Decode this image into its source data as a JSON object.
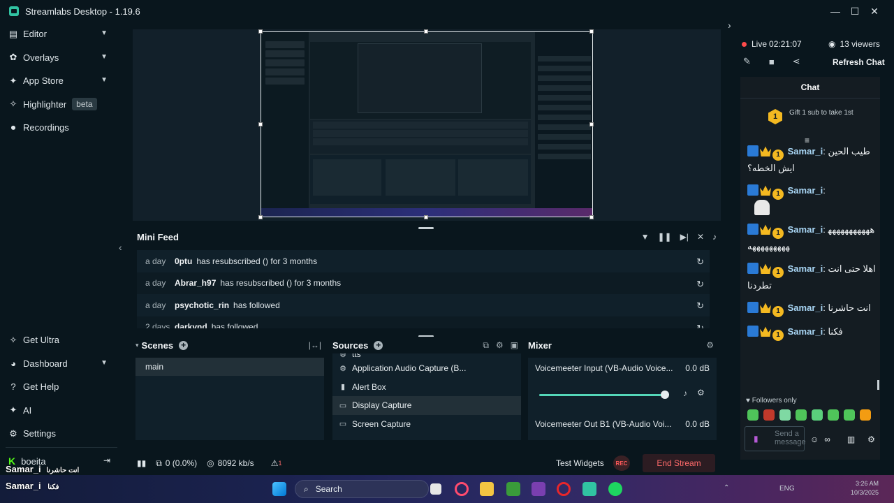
{
  "window": {
    "title": "Streamlabs Desktop - 1.19.6",
    "controls": [
      "—",
      "☐",
      "✕"
    ]
  },
  "sidebar": {
    "top_items": [
      {
        "label": "Editor",
        "icon": "editor-icon",
        "glyph": "▤",
        "chevron": true
      },
      {
        "label": "Overlays",
        "icon": "overlays-icon",
        "glyph": "✿",
        "chevron": true
      },
      {
        "label": "App Store",
        "icon": "app-store-icon",
        "glyph": "✦",
        "chevron": true
      },
      {
        "label": "Highlighter",
        "icon": "highlighter-icon",
        "glyph": "✧",
        "badge": "beta"
      },
      {
        "label": "Recordings",
        "icon": "recordings-icon",
        "glyph": "⏺"
      }
    ],
    "bottom_items": [
      {
        "label": "Get Ultra",
        "icon": "ultra-icon",
        "glyph": "✧"
      },
      {
        "label": "Dashboard",
        "icon": "dashboard-icon",
        "glyph": "◕",
        "chevron": true
      },
      {
        "label": "Get Help",
        "icon": "help-icon",
        "glyph": "?"
      },
      {
        "label": "AI",
        "icon": "ai-icon",
        "glyph": "✦"
      },
      {
        "label": "Settings",
        "icon": "settings-icon",
        "glyph": "⚙"
      }
    ],
    "user": "boeita"
  },
  "mini_feed": {
    "title": "Mini Feed",
    "events": [
      {
        "time": "a day",
        "user": "0ptu",
        "message": "has resubscribed () for 3 months"
      },
      {
        "time": "a day",
        "user": "Abrar_h97",
        "message": "has resubscribed () for 3 months"
      },
      {
        "time": "a day",
        "user": "psychotic_rin",
        "message": "has followed"
      },
      {
        "time": "2 days",
        "user": "darkvnd",
        "message": "has followed"
      }
    ]
  },
  "scenes": {
    "title": "Scenes",
    "items": [
      "main"
    ]
  },
  "sources": {
    "title": "Sources",
    "items": [
      {
        "label": "tts",
        "icon": "tts-icon",
        "glyph": "⚙"
      },
      {
        "label": "Application Audio Capture (B...",
        "icon": "audio-capture-icon",
        "glyph": "⚙"
      },
      {
        "label": "Alert Box",
        "icon": "alert-box-icon",
        "glyph": "▮"
      },
      {
        "label": "Display Capture",
        "icon": "display-capture-icon",
        "glyph": "▭",
        "selected": true
      },
      {
        "label": "Screen Capture",
        "icon": "screen-capture-icon",
        "glyph": "▭"
      }
    ]
  },
  "mixer": {
    "title": "Mixer",
    "channels": [
      {
        "name": "Voicemeeter Input (VB-Audio Voice...",
        "level": "0.0 dB",
        "volume_fraction": 1.0
      },
      {
        "name": "Voicemeeter Out B1 (VB-Audio Voi...",
        "level": "0.0 dB"
      }
    ]
  },
  "status_bar": {
    "dropped_frames": "0 (0.0%)",
    "bitrate": "8092 kb/s",
    "alert_count": "1",
    "test_widgets": "Test Widgets",
    "rec_label": "REC",
    "end_stream": "End Stream"
  },
  "stream_panel": {
    "live_label": "Live",
    "live_time": "02:21:07",
    "viewers": "13 viewers",
    "refresh_chat": "Refresh Chat",
    "chat": {
      "title": "Chat",
      "gift_count": "1",
      "gift_text": "Gift 1 sub to take 1st",
      "messages": [
        {
          "user": "Samar_i",
          "text": "طيب الحين ايش الخطه؟"
        },
        {
          "user": "Samar_i",
          "text": ""
        },
        {
          "user": "Samar_i",
          "text": "ههههههههههههههههههههه"
        },
        {
          "user": "Samar_i",
          "text": "اهلا حتى انت تطردنا"
        },
        {
          "user": "Samar_i",
          "text": "انت حاشرنا"
        },
        {
          "user": "Samar_i",
          "text": "فكنا"
        }
      ],
      "followers_only": "Followers only",
      "input_placeholder": "Send a message"
    }
  },
  "overlay": {
    "caption_user": "Samar_i",
    "caption_text": "انت حاشرنا",
    "caption_user2": "Samar_i",
    "caption_text2": "فكنا"
  },
  "taskbar": {
    "search_placeholder": "Search",
    "language": "ENG",
    "time": "3:26 AM",
    "date": "10/3/2025"
  },
  "colors": {
    "background": "#09161d",
    "accent": "#31c3a2",
    "live": "#ff4b4b",
    "end_stream_text": "#ff6a6a"
  }
}
